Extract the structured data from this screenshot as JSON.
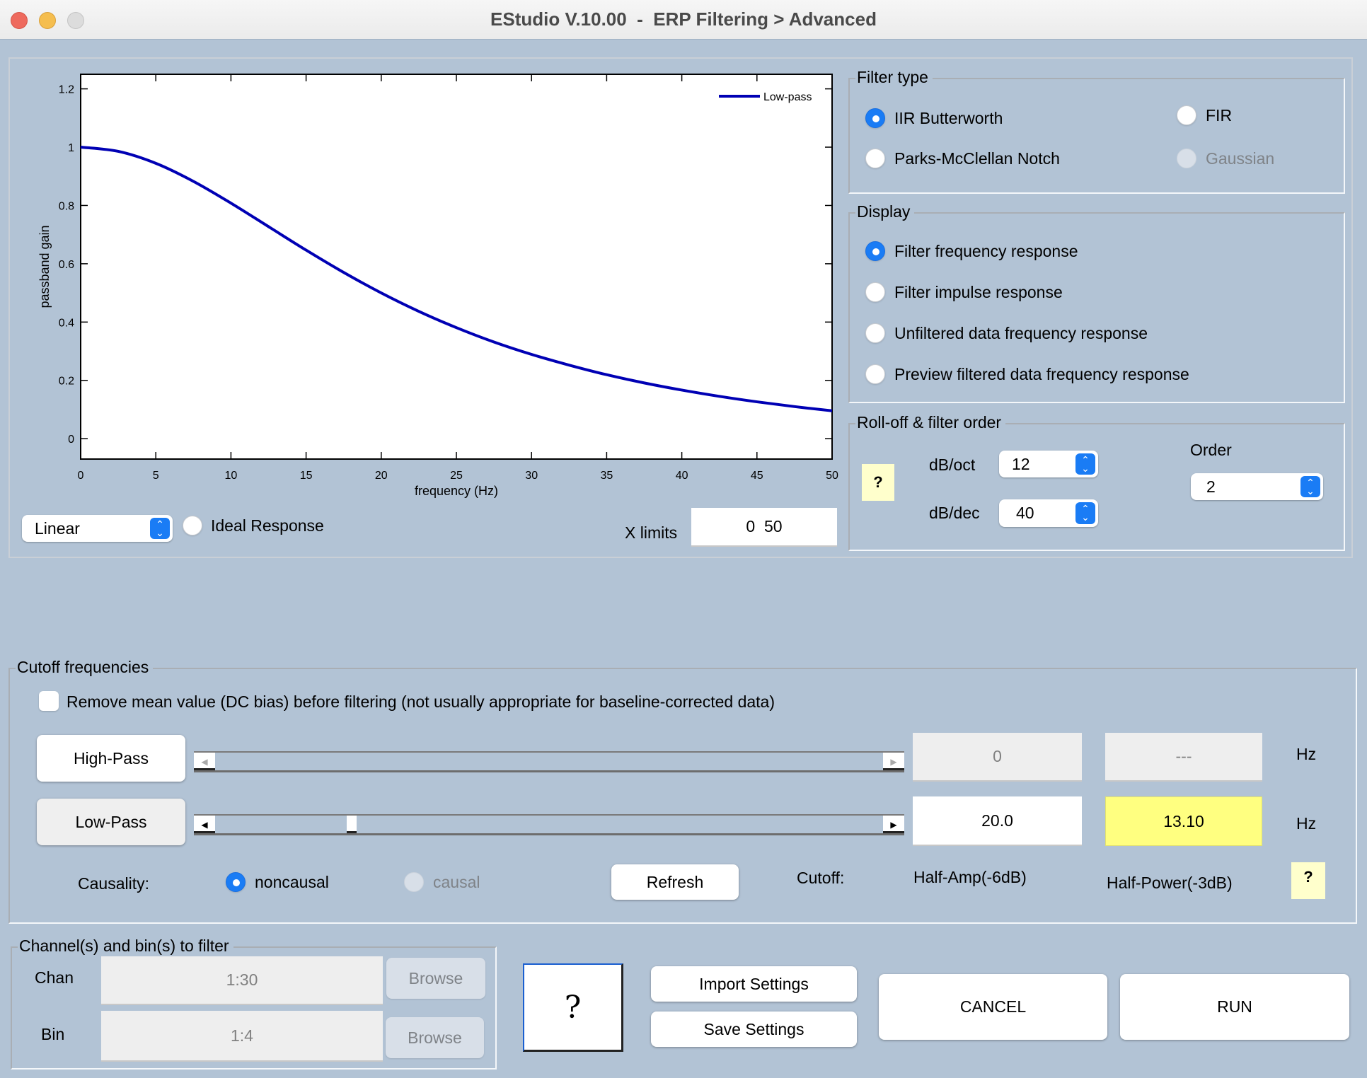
{
  "window": {
    "title": "EStudio V.10.00  -  ERP Filtering > Advanced"
  },
  "plot_controls": {
    "scale_select": "Linear",
    "ideal_response_label": "Ideal Response",
    "ideal_response_checked": false,
    "xlimits_label": "X limits",
    "xlimits_value": "0  50"
  },
  "filter_type": {
    "title": "Filter type",
    "options": [
      {
        "label": "IIR Butterworth",
        "selected": true,
        "enabled": true
      },
      {
        "label": "FIR",
        "selected": false,
        "enabled": true
      },
      {
        "label": "Parks-McClellan Notch",
        "selected": false,
        "enabled": true
      },
      {
        "label": "Gaussian",
        "selected": false,
        "enabled": false
      }
    ]
  },
  "display": {
    "title": "Display",
    "options": [
      {
        "label": "Filter frequency response",
        "selected": true
      },
      {
        "label": "Filter impulse response",
        "selected": false
      },
      {
        "label": "Unfiltered data frequency response",
        "selected": false
      },
      {
        "label": "Preview filtered data frequency response",
        "selected": false
      }
    ]
  },
  "rolloff": {
    "title": "Roll-off & filter order",
    "help_label": "?",
    "db_oct_label": "dB/oct",
    "db_oct_value": "12",
    "db_dec_label": "dB/dec",
    "db_dec_value": "40",
    "order_label": "Order",
    "order_value": "2"
  },
  "cutoff": {
    "title": "Cutoff frequencies",
    "remove_dc_label": "Remove mean value (DC bias) before filtering (not usually appropriate for baseline-corrected data)",
    "remove_dc_checked": false,
    "highpass": {
      "button_label": "High-Pass",
      "slider_position": 0.0,
      "half_amp_value": "0",
      "half_power_value": "---",
      "unit": "Hz"
    },
    "lowpass": {
      "button_label": "Low-Pass",
      "slider_position": 0.2,
      "half_amp_value": "20.0",
      "half_power_value": "13.10",
      "unit": "Hz"
    },
    "causality_label": "Causality:",
    "noncausal_label": "noncausal",
    "causal_label": "causal",
    "refresh_label": "Refresh",
    "cutoff_label": "Cutoff:",
    "half_amp_label": "Half-Amp(-6dB)",
    "half_power_label": "Half-Power(-3dB)",
    "help_label": "?"
  },
  "channels": {
    "title": "Channel(s)  and bin(s) to filter",
    "chan_label": "Chan",
    "chan_value": "1:30",
    "bin_label": "Bin",
    "bin_value": "1:4",
    "browse_label": "Browse"
  },
  "footer": {
    "help_label": "?",
    "import_label": "Import Settings",
    "save_label": "Save Settings",
    "cancel_label": "CANCEL",
    "run_label": "RUN"
  },
  "colors": {
    "curve": "#0000b4",
    "accent": "#1a7cf5",
    "background": "#b2c3d5",
    "highlight": "#ffff80"
  },
  "chart_data": {
    "type": "line",
    "title": "",
    "xlabel": "frequency (Hz)",
    "ylabel": "passband gain",
    "xlim": [
      0,
      50
    ],
    "ylim": [
      -0.07,
      1.25
    ],
    "xticks": [
      0,
      5,
      10,
      15,
      20,
      25,
      30,
      35,
      40,
      45,
      50
    ],
    "yticks": [
      0,
      0.2,
      0.4,
      0.6,
      0.8,
      1,
      1.2
    ],
    "ytick_labels": [
      "0",
      "0.2",
      "0.4",
      "0.6",
      "0.8",
      "1",
      "1.2"
    ],
    "grid": false,
    "legend": {
      "position": "top-right",
      "entries": [
        "Low-pass"
      ]
    },
    "series": [
      {
        "name": "Low-pass",
        "x": [
          0,
          2.5,
          5,
          7.5,
          10,
          12.5,
          15,
          17.5,
          20,
          22.5,
          25,
          27.5,
          30,
          32.5,
          35,
          37.5,
          40,
          42.5,
          45,
          47.5,
          50
        ],
        "y": [
          1.0,
          0.9856,
          0.9446,
          0.8828,
          0.808,
          0.7274,
          0.6468,
          0.5703,
          0.5,
          0.4368,
          0.3809,
          0.3316,
          0.2891,
          0.2524,
          0.2194,
          0.1912,
          0.1667,
          0.1452,
          0.1264,
          0.11,
          0.0955
        ]
      }
    ]
  }
}
